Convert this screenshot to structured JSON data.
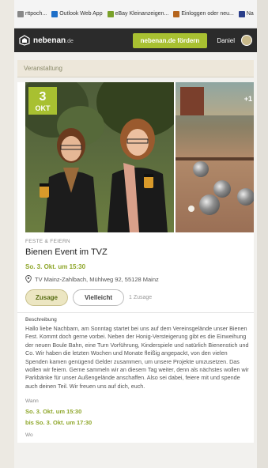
{
  "bookmarks": [
    {
      "label": "rttpoch...",
      "color": "#888888"
    },
    {
      "label": "Outlook Web App",
      "color": "#1e6fc8"
    },
    {
      "label": "eBay Kleinanzeigen...",
      "color": "#7aa12a"
    },
    {
      "label": "Einloggen oder neu...",
      "color": "#b5651d"
    },
    {
      "label": "Na",
      "color": "#2a3e8a"
    }
  ],
  "header": {
    "logo": "nebenan",
    "logo_suffix": ".de",
    "promote_label": "nebenan.de fördern",
    "user_name": "Daniel"
  },
  "section": {
    "label": "Veranstaltung"
  },
  "event": {
    "badge_day": "3",
    "badge_month": "OKT",
    "more_photos": "+1",
    "category": "FESTE & FEIERN",
    "title": "Bienen Event im TVZ",
    "datetime": "So. 3. Okt. um 15:30",
    "location": "TV Mainz-Zahlbach, Mühlweg 92, 55128 Mainz",
    "attend_label": "Zusage",
    "maybe_label": "Vielleicht",
    "attend_count": "1 Zusage",
    "description_label": "Beschreibung",
    "description": "Hallo liebe Nachbarn, am Sonntag startet bei uns auf dem Vereinsgelände unser Bienen Fest. Kommt doch gerne vorbei. Neben der Honig-Versteigerung gibt es die Einweihung der neuen Boule Bahn, eine Turn Vorführung, Kinderspiele und natürlich Bienenstich und Co. Wir haben die letzten Wochen und Monate fleißig angepackt, von den vielen Spenden kamen genügend Gelder zusammen, um unsere Projekte umzusetzen. Das wollen wir feiern. Gerne sammeln wir an diesem Tag weiter, denn als nächstes wollen wir Parkbänke für unser Außengelände anschaffen. Also sei dabei, feiere mit und spende auch deinen Teil. Wir freuen uns auf dich, euch.",
    "when_label": "Wann",
    "when_start": "So. 3. Okt. um 15:30",
    "when_end": "bis So. 3. Okt. um 17:30",
    "where_label": "Wo"
  },
  "colors": {
    "accent": "#a8c031",
    "topbar": "#2b2b2b"
  }
}
